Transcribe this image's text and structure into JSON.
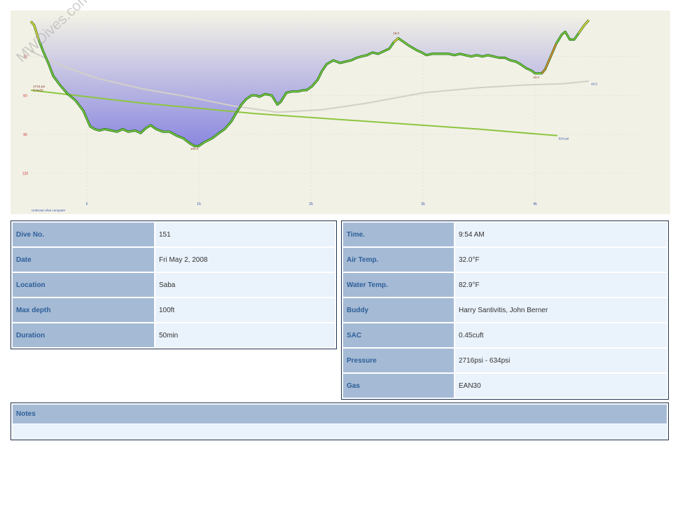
{
  "watermark": "MWDives.com",
  "chart_data": {
    "type": "line",
    "title": "",
    "xlabel": "",
    "ylabel": "",
    "xlim": [
      0,
      55
    ],
    "ylim": [
      0,
      135
    ],
    "x_ticks": [
      "5",
      "15",
      "25",
      "35",
      "45"
    ],
    "x_tick_values": [
      5,
      15,
      25,
      35,
      45
    ],
    "y_ticks": [
      "30",
      "60",
      "90",
      "120"
    ],
    "y_tick_values": [
      30,
      60,
      90,
      120
    ],
    "series": [
      {
        "role": "depth",
        "color": "#2e8b2e",
        "points": [
          [
            0,
            3
          ],
          [
            0.3,
            6
          ],
          [
            0.7,
            17
          ],
          [
            1.1,
            26
          ],
          [
            1.6,
            36
          ],
          [
            2,
            45
          ],
          [
            2.6,
            52
          ],
          [
            3.3,
            59
          ],
          [
            4,
            64
          ],
          [
            4.7,
            72
          ],
          [
            5,
            78
          ],
          [
            5.3,
            84
          ],
          [
            5.7,
            86
          ],
          [
            6.1,
            87
          ],
          [
            6.6,
            86
          ],
          [
            7.2,
            87
          ],
          [
            7.7,
            88
          ],
          [
            8.2,
            86
          ],
          [
            8.7,
            88
          ],
          [
            9.3,
            87
          ],
          [
            9.8,
            89
          ],
          [
            10.3,
            85
          ],
          [
            10.7,
            83
          ],
          [
            11.2,
            86
          ],
          [
            11.8,
            88
          ],
          [
            12.4,
            88
          ],
          [
            13,
            91
          ],
          [
            13.6,
            93
          ],
          [
            14.2,
            97
          ],
          [
            14.6,
            99
          ],
          [
            15,
            99
          ],
          [
            15.5,
            96
          ],
          [
            16.2,
            93
          ],
          [
            16.8,
            89
          ],
          [
            17.3,
            86
          ],
          [
            17.9,
            80
          ],
          [
            18.3,
            74
          ],
          [
            18.8,
            67
          ],
          [
            19.2,
            63
          ],
          [
            19.7,
            60
          ],
          [
            20.1,
            60
          ],
          [
            20.4,
            61
          ],
          [
            20.9,
            59
          ],
          [
            21.5,
            60
          ],
          [
            22,
            67
          ],
          [
            22.3,
            65
          ],
          [
            22.8,
            58
          ],
          [
            23.3,
            57
          ],
          [
            23.8,
            57
          ],
          [
            24.3,
            56
          ],
          [
            24.6,
            56
          ],
          [
            25.1,
            53
          ],
          [
            25.6,
            48
          ],
          [
            26,
            41
          ],
          [
            26.4,
            36
          ],
          [
            27,
            33
          ],
          [
            27.6,
            35
          ],
          [
            28.1,
            34
          ],
          [
            28.6,
            33
          ],
          [
            29.1,
            31
          ],
          [
            29.5,
            30
          ],
          [
            30,
            29
          ],
          [
            30.5,
            27
          ],
          [
            31,
            28
          ],
          [
            31.5,
            26
          ],
          [
            32,
            24
          ],
          [
            32.4,
            19
          ],
          [
            32.8,
            16
          ],
          [
            33.3,
            19
          ],
          [
            33.8,
            22
          ],
          [
            34.4,
            25
          ],
          [
            34.9,
            27
          ],
          [
            35.3,
            29
          ],
          [
            35.8,
            28
          ],
          [
            36.3,
            28
          ],
          [
            36.8,
            28
          ],
          [
            37.3,
            28
          ],
          [
            37.8,
            29
          ],
          [
            38.3,
            28
          ],
          [
            38.8,
            29
          ],
          [
            39.3,
            30
          ],
          [
            39.8,
            29
          ],
          [
            40.3,
            30
          ],
          [
            40.8,
            29
          ],
          [
            41.3,
            30
          ],
          [
            41.8,
            31
          ],
          [
            42.3,
            31
          ],
          [
            42.8,
            33
          ],
          [
            43.3,
            34
          ],
          [
            43.7,
            36
          ],
          [
            44.2,
            39
          ],
          [
            44.7,
            41
          ],
          [
            45,
            43
          ],
          [
            45.6,
            43
          ],
          [
            45.9,
            40
          ],
          [
            46.4,
            30
          ],
          [
            46.9,
            20
          ],
          [
            47.4,
            13
          ],
          [
            47.7,
            11
          ],
          [
            48.1,
            17
          ],
          [
            48.5,
            17
          ],
          [
            48.9,
            12
          ],
          [
            49.4,
            6
          ],
          [
            49.8,
            2
          ]
        ]
      },
      {
        "role": "tank pressure",
        "color": "#8cc63f",
        "points": [
          [
            0,
            56
          ],
          [
            10,
            66
          ],
          [
            20,
            74
          ],
          [
            30,
            80
          ],
          [
            40,
            86
          ],
          [
            47,
            91
          ]
        ]
      },
      {
        "role": "secondary trace",
        "color": "#d2d0c8",
        "points": [
          [
            0,
            26
          ],
          [
            3,
            38
          ],
          [
            6,
            47
          ],
          [
            10,
            55
          ],
          [
            14,
            61
          ],
          [
            18,
            68
          ],
          [
            22,
            73
          ],
          [
            26,
            71
          ],
          [
            30,
            66
          ],
          [
            35,
            58
          ],
          [
            40,
            54
          ],
          [
            44,
            52
          ],
          [
            47.5,
            51
          ],
          [
            49.8,
            49
          ]
        ]
      }
    ],
    "annotations": [
      {
        "text": "2716 psi",
        "x": 0.2,
        "y": 54
      },
      {
        "text": "EAN30",
        "x": 0.2,
        "y": 57
      },
      {
        "text": "100.0",
        "x": 14.6,
        "y": 102
      },
      {
        "text": "16.0",
        "x": 32.6,
        "y": 13
      },
      {
        "text": "43.0",
        "x": 45.1,
        "y": 47
      },
      {
        "text": "634 psi",
        "x": 47.1,
        "y": 94
      },
      {
        "text": "49.9",
        "x": 50,
        "y": 52
      }
    ],
    "footer_label": "Unknown dive computer",
    "colors": {
      "background": "#f2f1e6",
      "fill_top": "#f0efe6",
      "fill_bottom": "#8a86e0",
      "tank": "#8cc63f",
      "depth_axis_labels": "#cc3333",
      "time_axis_labels": "#3a56a8",
      "grid": "#dcdcd0"
    }
  },
  "dive_info": [
    {
      "label": "Dive No.",
      "value": "151"
    },
    {
      "label": "Date",
      "value": "Fri May 2, 2008"
    },
    {
      "label": "Location",
      "value": "Saba"
    },
    {
      "label": "Max depth",
      "value": "100ft"
    },
    {
      "label": "Duration",
      "value": "50min"
    }
  ],
  "conditions": [
    {
      "label": "Time.",
      "value": "9:54 AM"
    },
    {
      "label": "Air Temp.",
      "value": "32.0°F"
    },
    {
      "label": "Water Temp.",
      "value": "82.9°F"
    },
    {
      "label": "Buddy",
      "value": "Harry Santivitis, John Berner"
    },
    {
      "label": "SAC",
      "value": "0.45cuft"
    },
    {
      "label": "Pressure",
      "value": "2716psi - 634psi"
    },
    {
      "label": "Gas",
      "value": "EAN30"
    }
  ],
  "notes": {
    "label": "Notes",
    "text": ""
  }
}
